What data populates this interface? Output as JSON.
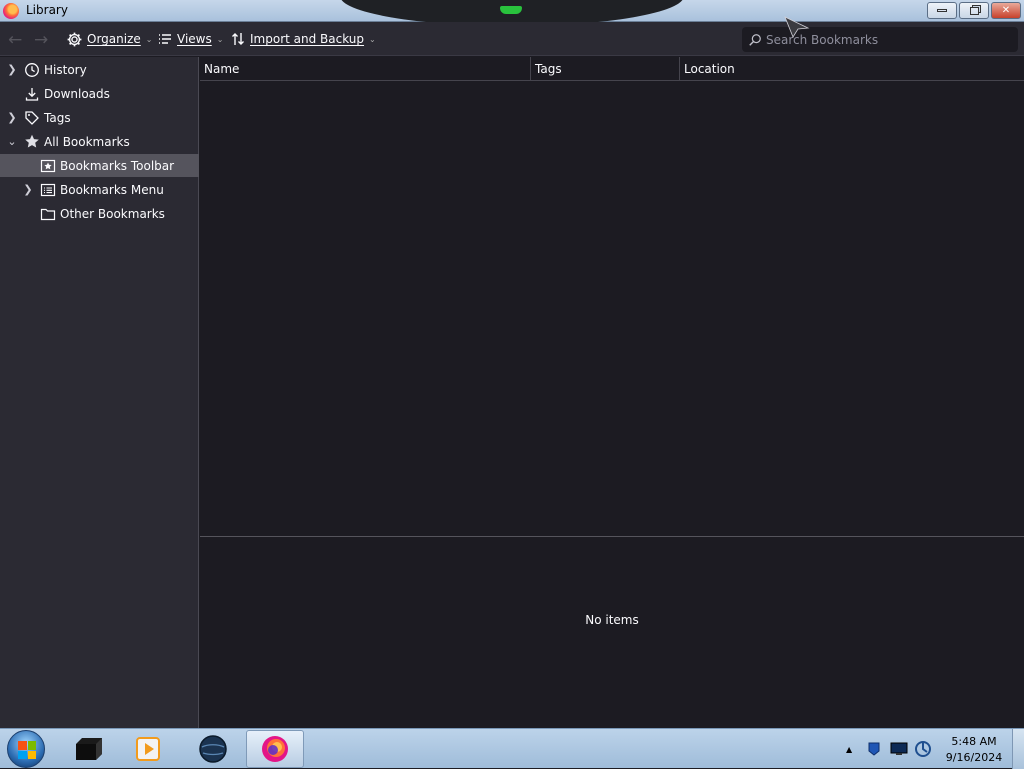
{
  "window": {
    "title": "Library",
    "buttons": {
      "minimize": "▭",
      "restore": "🗗",
      "close": "✕"
    }
  },
  "toolbar": {
    "back_icon": "arrow-left",
    "forward_icon": "arrow-right",
    "organize_label": "Organize",
    "views_label": "Views",
    "import_backup_label": "Import and Backup",
    "search_placeholder": "Search Bookmarks"
  },
  "sidebar": {
    "items": [
      {
        "label": "History",
        "icon": "clock-icon",
        "expandable": true,
        "expanded": false,
        "selected": false
      },
      {
        "label": "Downloads",
        "icon": "download-icon",
        "expandable": false,
        "expanded": false,
        "selected": false
      },
      {
        "label": "Tags",
        "icon": "tag-icon",
        "expandable": true,
        "expanded": false,
        "selected": false
      },
      {
        "label": "All Bookmarks",
        "icon": "star-icon",
        "expandable": true,
        "expanded": true,
        "selected": false
      },
      {
        "label": "Bookmarks Toolbar",
        "icon": "bookmarks-toolbar-icon",
        "expandable": false,
        "expanded": false,
        "selected": true
      },
      {
        "label": "Bookmarks Menu",
        "icon": "bookmarks-menu-icon",
        "expandable": true,
        "expanded": false,
        "selected": false
      },
      {
        "label": "Other Bookmarks",
        "icon": "folder-icon",
        "expandable": false,
        "expanded": false,
        "selected": false
      }
    ]
  },
  "main": {
    "columns": [
      "Name",
      "Tags",
      "Location"
    ],
    "empty_text": "No items"
  },
  "taskbar": {
    "pinned": [
      "file-manager-icon",
      "media-player-icon",
      "network-globe-icon",
      "firefox-icon"
    ],
    "clock_time": "5:48 AM",
    "clock_date": "9/16/2024"
  },
  "colors": {
    "accent_selected": "#55545d",
    "sidebar_bg": "#2b2a33",
    "content_bg": "#1c1b22",
    "text": "#fbfbfe"
  }
}
